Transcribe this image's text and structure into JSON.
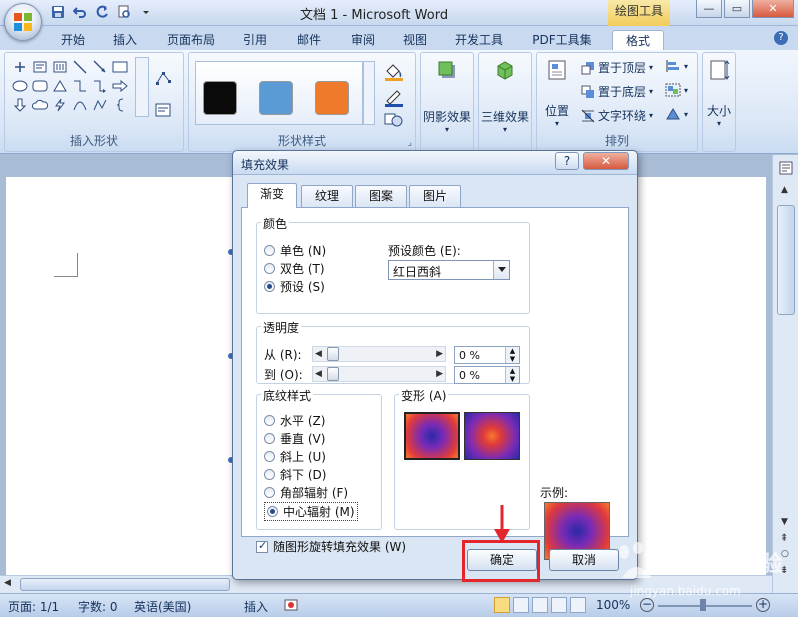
{
  "window": {
    "title": "文档 1 - Microsoft Word",
    "context_tab": "绘图工具"
  },
  "ribbon": {
    "tabs": [
      "开始",
      "插入",
      "页面布局",
      "引用",
      "邮件",
      "审阅",
      "视图",
      "开发工具",
      "PDF工具集",
      "格式"
    ],
    "active_tab": "格式",
    "groups": {
      "insert_shapes": "插入形状",
      "shape_styles": "形状样式",
      "arrange": "排列"
    },
    "style_swatch_colors": [
      "#0a0a0a",
      "#5a9bd5",
      "#f07a2c"
    ],
    "buttons": {
      "shadow_effects": "阴影效果",
      "effects_3d": "三维效果",
      "position": "位置",
      "bring_front": "置于顶层",
      "send_back": "置于底层",
      "text_wrap": "文字环绕",
      "size": "大小"
    }
  },
  "dialog": {
    "title": "填充效果",
    "tabs": [
      "渐变",
      "纹理",
      "图案",
      "图片"
    ],
    "active_tab": "渐变",
    "colors": {
      "label": "颜色",
      "options": [
        "单色 (N)",
        "双色 (T)",
        "预设 (S)"
      ],
      "selected": 2,
      "preset_label": "预设颜色 (E):",
      "preset_value": "红日西斜"
    },
    "transparency": {
      "label": "透明度",
      "from_label": "从 (R):",
      "to_label": "到 (O):",
      "from_value": "0 %",
      "to_value": "0 %"
    },
    "shading": {
      "label": "底纹样式",
      "options": [
        "水平 (Z)",
        "垂直 (V)",
        "斜上 (U)",
        "斜下 (D)",
        "角部辐射 (F)",
        "中心辐射 (M)"
      ],
      "selected": 5
    },
    "variants_label": "变形 (A)",
    "sample_label": "示例:",
    "rotate_checkbox": "随图形旋转填充效果 (W)",
    "ok": "确定",
    "cancel": "取消"
  },
  "status": {
    "page": "页面: 1/1",
    "words": "字数: 0",
    "language": "英语(美国)",
    "insert": "插入",
    "zoom": "100%"
  },
  "watermark": {
    "text": "Baidu 经验",
    "url": "jingyan.baidu.com"
  }
}
